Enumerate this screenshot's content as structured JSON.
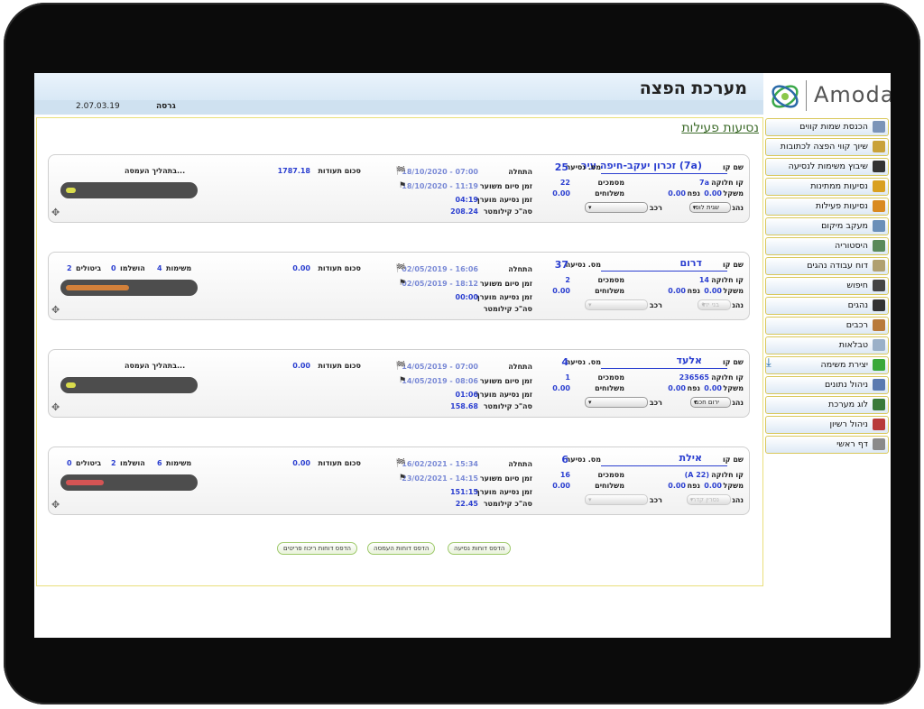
{
  "app": {
    "title": "מערכת הפצה",
    "version_label": "גרסה",
    "version": "2.07.03.19",
    "brand": "Amodat"
  },
  "page": {
    "title": "נסיעות פעילות"
  },
  "labels": {
    "line_name": "שם קו",
    "trip_num": "מס. נסיעה",
    "dist_line": "קו חלוקה",
    "docs": "מסמכים",
    "weight": "משקל",
    "volume": "נפח",
    "shipments": "משלוחים",
    "driver": "נהג",
    "vehicle": "רכב",
    "start": "התחלה",
    "est_end": "זמן סיום משוער",
    "est_dur": "זמן נסיעה מוערך",
    "total_km": "סה\"כ קילומטר",
    "docs_total": "סכום תעודות",
    "tasks": "משימות",
    "completed": "הושלמו",
    "cancelled": "ביטולים"
  },
  "trips": [
    {
      "name": "(7a) זכרון יעקב-חיפה עיר",
      "trip_no": "25",
      "dist_line": "7a",
      "docs": "22",
      "weight": "0.00",
      "volume": "0.00",
      "shipments": "0.00",
      "driver": "שגית לופו",
      "vehicle": "",
      "start": "18/10/2020 - 07:00",
      "est_end": "18/10/2020 - 11:19",
      "est_dur": "04:19",
      "km": "208.24",
      "docs_total": "1787.18",
      "status_text": "בתהליך העמסה...",
      "tasks": "",
      "completed": "",
      "cancelled": "",
      "progress": 0.08,
      "bar_color": "#d9dc4c"
    },
    {
      "name": "דרום",
      "trip_no": "37",
      "dist_line": "14",
      "docs": "2",
      "weight": "0.00",
      "volume": "0.00",
      "shipments": "0.00",
      "driver": "בני יזל",
      "vehicle": "",
      "start": "02/05/2019 - 16:06",
      "est_end": "02/05/2019 - 18:12",
      "est_dur": "00:00",
      "km": "",
      "docs_total": "0.00",
      "status_text": "",
      "tasks": "4",
      "completed": "0",
      "cancelled": "2",
      "progress": 0.5,
      "bar_color": "#d2803a"
    },
    {
      "name": "אלעד",
      "trip_no": "4",
      "dist_line": "236565",
      "docs": "1",
      "weight": "0.00",
      "volume": "0.00",
      "shipments": "0.00",
      "driver": "ירום חכם",
      "vehicle": "",
      "start": "14/05/2019 - 07:00",
      "est_end": "14/05/2019 - 08:06",
      "est_dur": "01:06",
      "km": "158.68",
      "docs_total": "0.00",
      "status_text": "בתהליך העמסה...",
      "tasks": "",
      "completed": "",
      "cancelled": "",
      "progress": 0.08,
      "bar_color": "#d9dc4c"
    },
    {
      "name": "אילת",
      "trip_no": "6",
      "dist_line": "(A 22)",
      "docs": "16",
      "weight": "0.00",
      "volume": "0.00",
      "shipments": "0.00",
      "driver": "נסרין קדרי",
      "vehicle": "",
      "start": "16/02/2021 - 15:34",
      "est_end": "23/02/2021 - 14:15",
      "est_dur": "151:15",
      "km": "22.45",
      "docs_total": "0.00",
      "status_text": "",
      "tasks": "6",
      "completed": "2",
      "cancelled": "0",
      "progress": 0.3,
      "bar_color": "#d45454"
    }
  ],
  "buttons": {
    "print_trip": "הדפס דוחות נסיעה",
    "print_load": "הדפס דוחות העמסה",
    "print_items": "הדפס דוחות ריכוז פריטים"
  },
  "menu": [
    {
      "label": "הכנסת שמות קווים",
      "icon": "table-icon",
      "color": "#7b94b8"
    },
    {
      "label": "שיוך קווי הפצה לכתובות",
      "icon": "people-icon",
      "color": "#c9a23a"
    },
    {
      "label": "שיבוץ משימות לנסיעה",
      "icon": "edit-icon",
      "color": "#333333"
    },
    {
      "label": "נסיעות ממתינות",
      "icon": "truck-icon",
      "color": "#d9a020"
    },
    {
      "label": "נסיעות פעילות",
      "icon": "truck-icon",
      "color": "#d98a20"
    },
    {
      "label": "מעקב מיקום",
      "icon": "map-icon",
      "color": "#6a8fb8"
    },
    {
      "label": "היסטוריה",
      "icon": "clock-icon",
      "color": "#5a8a5a"
    },
    {
      "label": "דוח עבודה נהגים",
      "icon": "report-icon",
      "color": "#b0a070"
    },
    {
      "label": "חיפוש",
      "icon": "binoculars-icon",
      "color": "#444444"
    },
    {
      "label": "נהגים",
      "icon": "hat-icon",
      "color": "#333333"
    },
    {
      "label": "רכבים",
      "icon": "boxes-icon",
      "color": "#b87a3a"
    },
    {
      "label": "טבלאות",
      "icon": "sheet-icon",
      "color": "#9ab0c8"
    },
    {
      "label": "יצירת משימה",
      "icon": "add-icon",
      "color": "#3aa83a"
    },
    {
      "label": "ניהול נתונים",
      "icon": "truck-icon",
      "color": "#5a7ab0"
    },
    {
      "label": "לוג מערכת",
      "icon": "monitor-icon",
      "color": "#3a7a3a"
    },
    {
      "label": "ניהול רשיון",
      "icon": "license-icon",
      "color": "#b83a3a"
    },
    {
      "label": "דף ראשי",
      "icon": "home-icon",
      "color": "#8a8a8a"
    }
  ]
}
